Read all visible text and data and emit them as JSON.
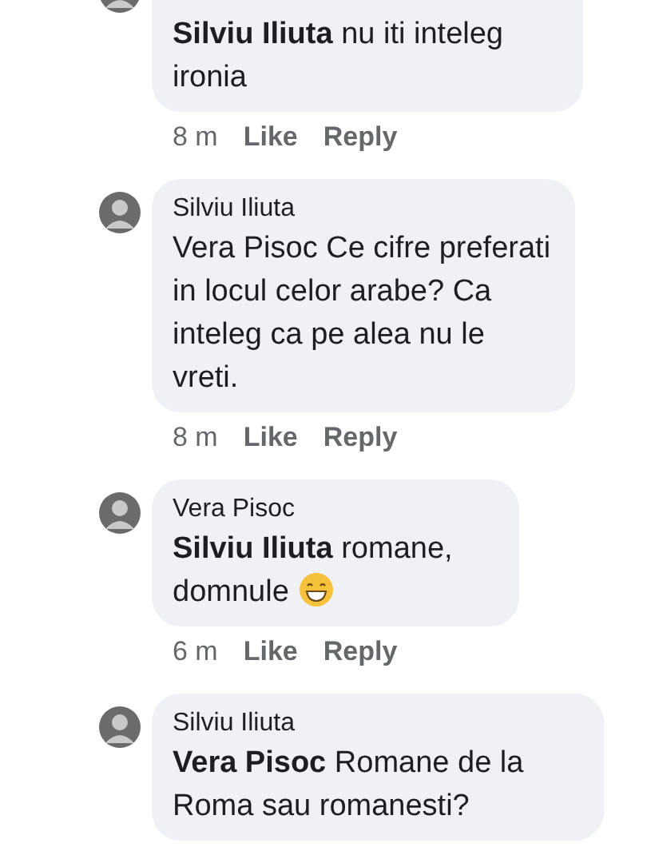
{
  "comments": [
    {
      "mention": "Silviu Iliuta",
      "text": "nu iti inteleg ironia",
      "time": "8 m",
      "like": "Like",
      "reply": "Reply"
    },
    {
      "author": "Silviu Iliuta",
      "text": "Vera Pisoc Ce cifre preferati in locul celor arabe? Ca inteleg ca pe alea nu le vreti.",
      "time": "8 m",
      "like": "Like",
      "reply": "Reply"
    },
    {
      "author": "Vera Pisoc",
      "mention": "Silviu Iliuta",
      "text": "romane, domnule",
      "emoji": true,
      "time": "6 m",
      "like": "Like",
      "reply": "Reply"
    },
    {
      "author": "Silviu Iliuta",
      "mention": "Vera Pisoc",
      "text": "Romane de la Roma sau romanesti?"
    }
  ]
}
